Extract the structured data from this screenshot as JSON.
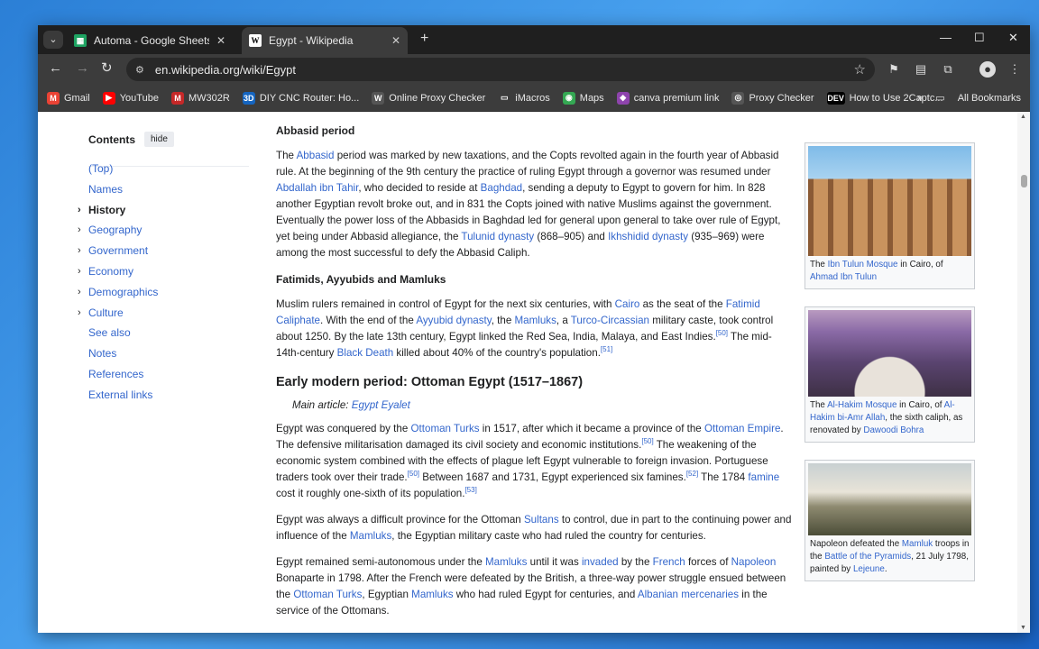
{
  "browser": {
    "tabs": [
      {
        "title": "Automa - Google Sheets",
        "active": false,
        "icon": "sheets-icon"
      },
      {
        "title": "Egypt - Wikipedia",
        "active": true,
        "icon": "wikipedia-icon"
      }
    ],
    "new_tab": "+",
    "url": "en.wikipedia.org/wiki/Egypt",
    "window_controls": {
      "minimize": "—",
      "maximize": "☐",
      "close": "✕"
    },
    "bookmarks": [
      {
        "label": "Gmail",
        "icon": "gmail-icon",
        "color": "#ea4335",
        "glyph": "M"
      },
      {
        "label": "YouTube",
        "icon": "youtube-icon",
        "color": "#ff0000",
        "glyph": "▶"
      },
      {
        "label": "MW302R",
        "icon": "mw-icon",
        "color": "#c62828",
        "glyph": "M"
      },
      {
        "label": "DIY CNC Router: Ho...",
        "icon": "3d-icon",
        "color": "#1565c0",
        "glyph": "3D"
      },
      {
        "label": "Online Proxy Checker",
        "icon": "wordpress-icon",
        "color": "#555555",
        "glyph": "W"
      },
      {
        "label": "iMacros",
        "icon": "folder-icon",
        "color": "#3c3c3c",
        "glyph": "▭"
      },
      {
        "label": "Maps",
        "icon": "maps-icon",
        "color": "#34a853",
        "glyph": "◉"
      },
      {
        "label": "canva premium link",
        "icon": "canva-icon",
        "color": "#8e44ad",
        "glyph": "◆"
      },
      {
        "label": "Proxy Checker",
        "icon": "globe-icon",
        "color": "#555555",
        "glyph": "◎"
      },
      {
        "label": "How to Use 2Captc...",
        "icon": "dev-icon",
        "color": "#000000",
        "glyph": "DEV"
      }
    ],
    "more_bookmarks": "»",
    "all_bookmarks": "All Bookmarks"
  },
  "toc": {
    "title": "Contents",
    "hide": "hide",
    "items": [
      {
        "label": "(Top)",
        "expandable": false,
        "current": false
      },
      {
        "label": "Names",
        "expandable": false,
        "current": false
      },
      {
        "label": "History",
        "expandable": true,
        "current": true
      },
      {
        "label": "Geography",
        "expandable": true,
        "current": false
      },
      {
        "label": "Government",
        "expandable": true,
        "current": false
      },
      {
        "label": "Economy",
        "expandable": true,
        "current": false
      },
      {
        "label": "Demographics",
        "expandable": true,
        "current": false
      },
      {
        "label": "Culture",
        "expandable": true,
        "current": false
      },
      {
        "label": "See also",
        "expandable": false,
        "current": false
      },
      {
        "label": "Notes",
        "expandable": false,
        "current": false
      },
      {
        "label": "References",
        "expandable": false,
        "current": false
      },
      {
        "label": "External links",
        "expandable": false,
        "current": false
      }
    ]
  },
  "article": {
    "abbasid_heading": "Abbasid period",
    "abbasid_p": [
      {
        "t": "The "
      },
      {
        "l": "Abbasid"
      },
      {
        "t": " period was marked by new taxations, and the Copts revolted again in the fourth year of Abbasid rule. At the beginning of the 9th century the practice of ruling Egypt through a governor was resumed under "
      },
      {
        "l": "Abdallah ibn Tahir"
      },
      {
        "t": ", who decided to reside at "
      },
      {
        "l": "Baghdad"
      },
      {
        "t": ", sending a deputy to Egypt to govern for him. In 828 another Egyptian revolt broke out, and in 831 the Copts joined with native Muslims against the government. Eventually the power loss of the Abbasids in Baghdad led for general upon general to take over rule of Egypt, yet being under Abbasid allegiance, the "
      },
      {
        "l": "Tulunid dynasty"
      },
      {
        "t": " (868–905) and "
      },
      {
        "l": "Ikhshidid dynasty"
      },
      {
        "t": " (935–969) were among the most successful to defy the Abbasid Caliph."
      }
    ],
    "fatimid_heading": "Fatimids, Ayyubids and Mamluks",
    "fatimid_p": [
      {
        "t": "Muslim rulers remained in control of Egypt for the next six centuries, with "
      },
      {
        "l": "Cairo"
      },
      {
        "t": " as the seat of the "
      },
      {
        "l": "Fatimid Caliphate"
      },
      {
        "t": ". With the end of the "
      },
      {
        "l": "Ayyubid dynasty"
      },
      {
        "t": ", the "
      },
      {
        "l": "Mamluks"
      },
      {
        "t": ", a "
      },
      {
        "l": "Turco-Circassian"
      },
      {
        "t": " military caste, took control about 1250. By the late 13th century, Egypt linked the Red Sea, India, Malaya, and East Indies."
      },
      {
        "s": "[50]"
      },
      {
        "t": " The mid-14th-century "
      },
      {
        "l": "Black Death"
      },
      {
        "t": " killed about 40% of the country's population."
      },
      {
        "s": "[51]"
      }
    ],
    "ottoman_heading": "Early modern period: Ottoman Egypt (1517–1867)",
    "hatnote_prefix": "Main article: ",
    "hatnote_link": "Egypt Eyalet",
    "ottoman_p1": [
      {
        "t": "Egypt was conquered by the "
      },
      {
        "l": "Ottoman Turks"
      },
      {
        "t": " in 1517, after which it became a province of the "
      },
      {
        "l": "Ottoman Empire"
      },
      {
        "t": ". The defensive militarisation damaged its civil society and economic institutions."
      },
      {
        "s": "[50]"
      },
      {
        "t": " The weakening of the economic system combined with the effects of plague left Egypt vulnerable to foreign invasion. Portuguese traders took over their trade."
      },
      {
        "s": "[50]"
      },
      {
        "t": " Between 1687 and 1731, Egypt experienced six famines."
      },
      {
        "s": "[52]"
      },
      {
        "t": " The 1784 "
      },
      {
        "l": "famine"
      },
      {
        "t": " cost it roughly one-sixth of its population."
      },
      {
        "s": "[53]"
      }
    ],
    "ottoman_p2": [
      {
        "t": "Egypt was always a difficult province for the Ottoman "
      },
      {
        "l": "Sultans"
      },
      {
        "t": " to control, due in part to the continuing power and influence of the "
      },
      {
        "l": "Mamluks"
      },
      {
        "t": ", the Egyptian military caste who had ruled the country for centuries."
      }
    ],
    "ottoman_p3": [
      {
        "t": "Egypt remained semi-autonomous under the "
      },
      {
        "l": "Mamluks"
      },
      {
        "t": " until it was "
      },
      {
        "l": "invaded"
      },
      {
        "t": " by the "
      },
      {
        "l": "French"
      },
      {
        "t": " forces of "
      },
      {
        "l": "Napoleon"
      },
      {
        "t": " Bonaparte in 1798. After the French were defeated by the British, a three-way power struggle ensued between the "
      },
      {
        "l": "Ottoman Turks"
      },
      {
        "t": ", Egyptian "
      },
      {
        "l": "Mamluks"
      },
      {
        "t": " who had ruled Egypt for centuries, and "
      },
      {
        "l": "Albanian mercenaries"
      },
      {
        "t": " in the service of the Ottomans."
      }
    ]
  },
  "thumbnails": [
    {
      "caption": [
        {
          "t": "The "
        },
        {
          "l": "Ibn Tulun Mosque"
        },
        {
          "t": " in Cairo, of "
        },
        {
          "l": "Ahmad Ibn Tulun"
        }
      ]
    },
    {
      "caption": [
        {
          "t": "The "
        },
        {
          "l": "Al-Hakim Mosque"
        },
        {
          "t": " in Cairo, of "
        },
        {
          "l": "Al-Hakim bi-Amr Allah"
        },
        {
          "t": ", the sixth caliph, as renovated by "
        },
        {
          "l": "Dawoodi Bohra"
        }
      ]
    },
    {
      "caption": [
        {
          "t": "Napoleon defeated the "
        },
        {
          "l": "Mamluk"
        },
        {
          "t": " troops in the "
        },
        {
          "l": "Battle of the Pyramids"
        },
        {
          "t": ", 21 July 1798, painted by "
        },
        {
          "l": "Lejeune"
        },
        {
          "t": "."
        }
      ]
    }
  ]
}
